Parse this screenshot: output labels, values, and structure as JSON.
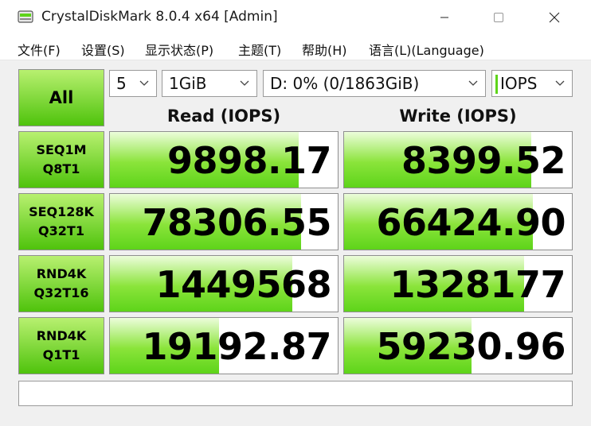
{
  "window": {
    "title": "CrystalDiskMark 8.0.4 x64 [Admin]",
    "icon": "disk-icon"
  },
  "menu": [
    {
      "label": "文件(F)"
    },
    {
      "label": "设置(S)"
    },
    {
      "label": "显示状态(P)"
    },
    {
      "label": "主题(T)"
    },
    {
      "label": "帮助(H)"
    },
    {
      "label": "语言(L)(Language)"
    }
  ],
  "controls": {
    "all_label": "All",
    "count": "5",
    "size": "1GiB",
    "drive": "D: 0% (0/1863GiB)",
    "unit": "IOPS"
  },
  "headers": {
    "read": "Read (IOPS)",
    "write": "Write (IOPS)"
  },
  "rows": [
    {
      "line1": "SEQ1M",
      "line2": "Q8T1",
      "read": "9898.17",
      "write": "8399.52",
      "read_fill": 0.83,
      "write_fill": 0.82
    },
    {
      "line1": "SEQ128K",
      "line2": "Q32T1",
      "read": "78306.55",
      "write": "66424.90",
      "read_fill": 0.84,
      "write_fill": 0.83
    },
    {
      "line1": "RND4K",
      "line2": "Q32T16",
      "read": "1449568",
      "write": "1328177",
      "read_fill": 0.8,
      "write_fill": 0.79
    },
    {
      "line1": "RND4K",
      "line2": "Q1T1",
      "read": "19192.87",
      "write": "59230.96",
      "read_fill": 0.48,
      "write_fill": 0.56
    }
  ],
  "comment": "",
  "colors": {
    "accent_green": "#5ed41a",
    "button_light_green": "#b8f070"
  }
}
